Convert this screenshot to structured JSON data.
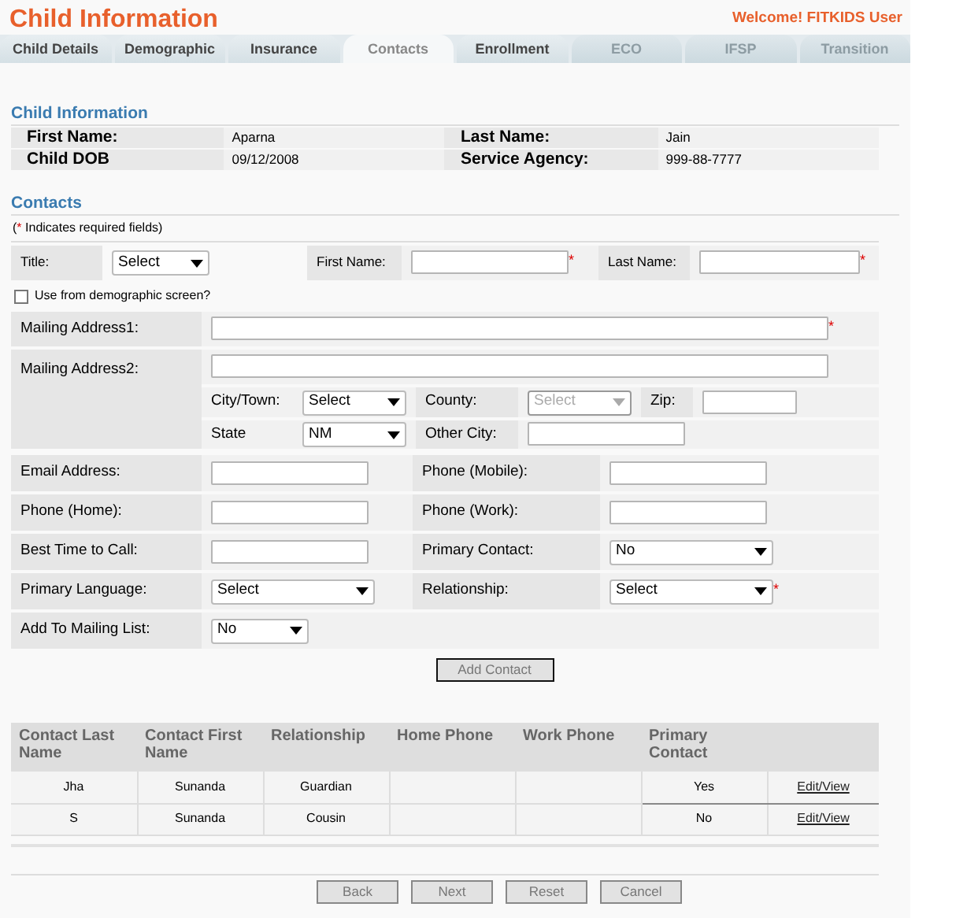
{
  "header": {
    "title": "Child Information",
    "welcome": "Welcome! FITKIDS User"
  },
  "tabs": [
    {
      "label": "Child Details",
      "selected": false,
      "disabled": false
    },
    {
      "label": "Demographic",
      "selected": false,
      "disabled": false
    },
    {
      "label": "Insurance",
      "selected": false,
      "disabled": false
    },
    {
      "label": "Contacts",
      "selected": true,
      "disabled": false
    },
    {
      "label": "Enrollment",
      "selected": false,
      "disabled": false
    },
    {
      "label": "ECO",
      "selected": false,
      "disabled": true
    },
    {
      "label": "IFSP",
      "selected": false,
      "disabled": true
    },
    {
      "label": "Transition",
      "selected": false,
      "disabled": true
    }
  ],
  "child_info": {
    "heading": "Child Information",
    "fields": [
      {
        "label": "First Name:",
        "value": "Aparna"
      },
      {
        "label": "Last Name:",
        "value": "Jain"
      },
      {
        "label": "Child DOB",
        "value": "09/12/2008"
      },
      {
        "label": "Service Agency:",
        "value": "999-88-7777"
      }
    ]
  },
  "contacts": {
    "heading": "Contacts",
    "note": {
      "open": "(",
      "mark": "*",
      "text": "Indicates required fields)"
    },
    "title": {
      "label": "Title:",
      "value": "Select"
    },
    "first_name": {
      "label": "First Name:",
      "required": true
    },
    "last_name": {
      "label": "Last Name:",
      "required": true
    },
    "use_demographic": {
      "label": "Use from demographic screen?",
      "checked": false
    },
    "address1": {
      "label": "Mailing Address1:",
      "required": true
    },
    "address2": {
      "label": "Mailing Address2:"
    },
    "city": {
      "label": "City/Town:",
      "value": "Select"
    },
    "county": {
      "label": "County:",
      "value": "Select",
      "disabled": true
    },
    "zip": {
      "label": "Zip:"
    },
    "state": {
      "label": "State",
      "value": "NM"
    },
    "other_city": {
      "label": "Other City:"
    },
    "rows": [
      [
        {
          "label": "Email Address:",
          "kind": "text"
        },
        {
          "label": "Phone (Mobile):",
          "kind": "text"
        }
      ],
      [
        {
          "label": "Phone (Home):",
          "kind": "text"
        },
        {
          "label": "Phone (Work):",
          "kind": "text"
        }
      ],
      [
        {
          "label": "Best Time to Call:",
          "kind": "text"
        },
        {
          "label": "Primary Contact:",
          "kind": "select",
          "value": "No"
        }
      ],
      [
        {
          "label": "Primary Language:",
          "kind": "select",
          "value": "Select"
        },
        {
          "label": "Relationship:",
          "kind": "select",
          "value": "Select",
          "required": true
        }
      ],
      [
        {
          "label": "Add To Mailing List:",
          "kind": "select",
          "value": "No",
          "short": true
        }
      ]
    ],
    "add_button": "Add Contact"
  },
  "table": {
    "columns": [
      "Contact Last Name",
      "Contact First Name",
      "Relationship",
      "Home Phone",
      "Work Phone",
      "Primary Contact"
    ],
    "rows": [
      {
        "cells": [
          "Jha",
          "Sunanda",
          "Guardian",
          "",
          "",
          "Yes"
        ],
        "action": "Edit/View"
      },
      {
        "cells": [
          "S",
          "Sunanda",
          "Cousin",
          "",
          "",
          "No"
        ],
        "action": "Edit/View"
      }
    ]
  },
  "buttons": [
    "Back",
    "Next",
    "Reset",
    "Cancel"
  ]
}
